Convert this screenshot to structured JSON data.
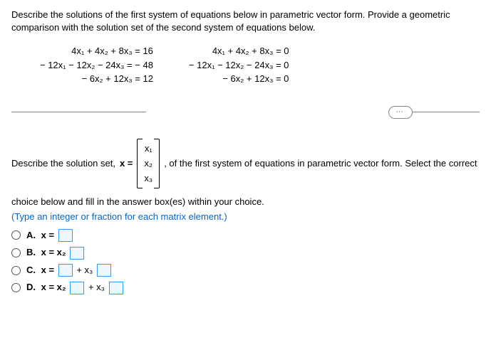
{
  "intro": "Describe the solutions of the first system of equations below in parametric vector form. Provide a geometric comparison with the solution set of the second system of equations below.",
  "system1": {
    "eq1": "4x₁ + 4x₂ + 8x₃ = 16",
    "eq2": "− 12x₁ − 12x₂ − 24x₃ = − 48",
    "eq3": "− 6x₂ + 12x₃ = 12"
  },
  "system2": {
    "eq1": "4x₁ + 4x₂ + 8x₃ = 0",
    "eq2": "− 12x₁ − 12x₂ − 24x₃ = 0",
    "eq3": "− 6x₂ + 12x₃ = 0"
  },
  "solset_pre": "Describe the solution set, ",
  "solset_xeq": "x =",
  "vec": {
    "r1": "x₁",
    "r2": "x₂",
    "r3": "x₃"
  },
  "solset_post": ", of the first system of equations in parametric vector form. Select the correct",
  "choice_line": "choice below and fill in the answer box(es) within your choice.",
  "type_line": "(Type an integer or fraction for each matrix element.)",
  "choices": {
    "A": {
      "label": "A.",
      "text_pre": "x ="
    },
    "B": {
      "label": "B.",
      "text_pre": "x = x₂"
    },
    "C": {
      "label": "C.",
      "text_pre": "x =",
      "text_mid": "+ x₃"
    },
    "D": {
      "label": "D.",
      "text_pre": "x = x₂",
      "text_mid": "+ x₃"
    }
  },
  "ellipsis": "⋯"
}
